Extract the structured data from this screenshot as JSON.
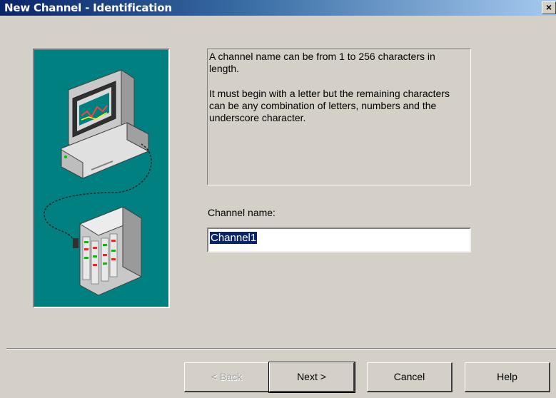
{
  "window": {
    "title": "New Channel - Identification",
    "close_label": "×"
  },
  "artwork": {
    "description_icon": "computer-connected-to-device-icon"
  },
  "info": {
    "paragraph1": "A channel name can be from 1 to 256 characters in length.",
    "paragraph2": "It must begin with a letter but the remaining characters can be any combination of letters, numbers and the underscore character."
  },
  "form": {
    "channel_name_label": "Channel name:",
    "channel_name_value": "Channel1"
  },
  "buttons": {
    "back": "< Back",
    "next": "Next >",
    "cancel": "Cancel",
    "help": "Help"
  }
}
